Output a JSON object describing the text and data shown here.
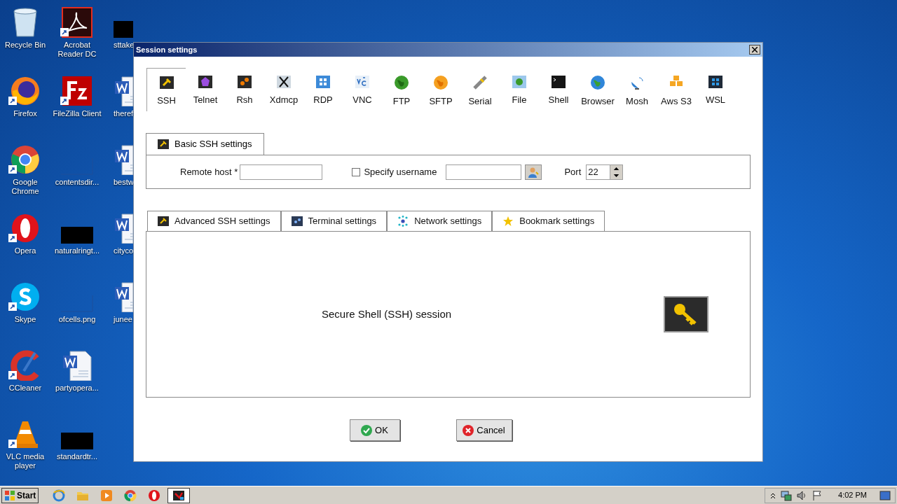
{
  "desktop": {
    "columns": [
      [
        {
          "label": "Recycle Bin",
          "kind": "recycle",
          "shortcut": false
        },
        {
          "label": "Firefox",
          "kind": "firefox",
          "shortcut": true
        },
        {
          "label": "Google Chrome",
          "kind": "chrome",
          "shortcut": true
        },
        {
          "label": "Opera",
          "kind": "opera",
          "shortcut": true
        },
        {
          "label": "Skype",
          "kind": "skype",
          "shortcut": true
        },
        {
          "label": "CCleaner",
          "kind": "ccleaner",
          "shortcut": true
        },
        {
          "label": "VLC media player",
          "kind": "vlc",
          "shortcut": true
        }
      ],
      [
        {
          "label": "Acrobat Reader DC",
          "kind": "acrobat",
          "shortcut": true
        },
        {
          "label": "FileZilla Client",
          "kind": "filezilla",
          "shortcut": true
        },
        {
          "label": "contentsdir...",
          "kind": "blank",
          "shortcut": false
        },
        {
          "label": "naturalringt...",
          "kind": "black",
          "shortcut": false
        },
        {
          "label": "ofcells.png",
          "kind": "blank",
          "shortcut": false
        },
        {
          "label": "partyopera...",
          "kind": "word",
          "shortcut": false
        },
        {
          "label": "standardtr...",
          "kind": "black",
          "shortcut": false
        }
      ],
      [
        {
          "label": "sttake",
          "kind": "black",
          "shortcut": false
        },
        {
          "label": "theref",
          "kind": "word",
          "shortcut": false
        },
        {
          "label": "bestw",
          "kind": "word",
          "shortcut": false
        },
        {
          "label": "cityco",
          "kind": "word",
          "shortcut": false
        },
        {
          "label": "junee",
          "kind": "word",
          "shortcut": false
        }
      ]
    ]
  },
  "dialog": {
    "title": "Session settings",
    "protocols": [
      {
        "label": "SSH",
        "kind": "ssh",
        "selected": true
      },
      {
        "label": "Telnet",
        "kind": "telnet",
        "selected": false
      },
      {
        "label": "Rsh",
        "kind": "rsh",
        "selected": false
      },
      {
        "label": "Xdmcp",
        "kind": "xdmcp",
        "selected": false
      },
      {
        "label": "RDP",
        "kind": "rdp",
        "selected": false
      },
      {
        "label": "VNC",
        "kind": "vnc",
        "selected": false
      },
      {
        "label": "FTP",
        "kind": "ftp",
        "selected": false
      },
      {
        "label": "SFTP",
        "kind": "sftp",
        "selected": false
      },
      {
        "label": "Serial",
        "kind": "serial",
        "selected": false
      },
      {
        "label": "File",
        "kind": "file",
        "selected": false
      },
      {
        "label": "Shell",
        "kind": "shell",
        "selected": false
      },
      {
        "label": "Browser",
        "kind": "browser",
        "selected": false
      },
      {
        "label": "Mosh",
        "kind": "mosh",
        "selected": false
      },
      {
        "label": "Aws S3",
        "kind": "aws",
        "selected": false
      },
      {
        "label": "WSL",
        "kind": "wsl",
        "selected": false
      }
    ],
    "basic_tab": {
      "label": "Basic SSH settings"
    },
    "remote_host": {
      "label": "Remote host *"
    },
    "specify_username": {
      "label": "Specify username",
      "checked": false
    },
    "port": {
      "label": "Port",
      "value": "22"
    },
    "settings_tabs": [
      {
        "label": "Advanced SSH settings",
        "kind": "ssh"
      },
      {
        "label": "Terminal settings",
        "kind": "terminal"
      },
      {
        "label": "Network settings",
        "kind": "network"
      },
      {
        "label": "Bookmark settings",
        "kind": "star"
      }
    ],
    "description": "Secure Shell (SSH) session",
    "buttons": [
      {
        "label": "OK",
        "kind": "ok"
      },
      {
        "label": "Cancel",
        "kind": "cancel"
      }
    ]
  },
  "taskbar": {
    "start": "Start",
    "apps": [
      {
        "kind": "ie",
        "selected": false
      },
      {
        "kind": "folder",
        "selected": false
      },
      {
        "kind": "media",
        "selected": false
      },
      {
        "kind": "chrome",
        "selected": false
      },
      {
        "kind": "opera",
        "selected": false
      },
      {
        "kind": "mobaxterm",
        "selected": true
      }
    ],
    "time": "4:02 PM"
  }
}
